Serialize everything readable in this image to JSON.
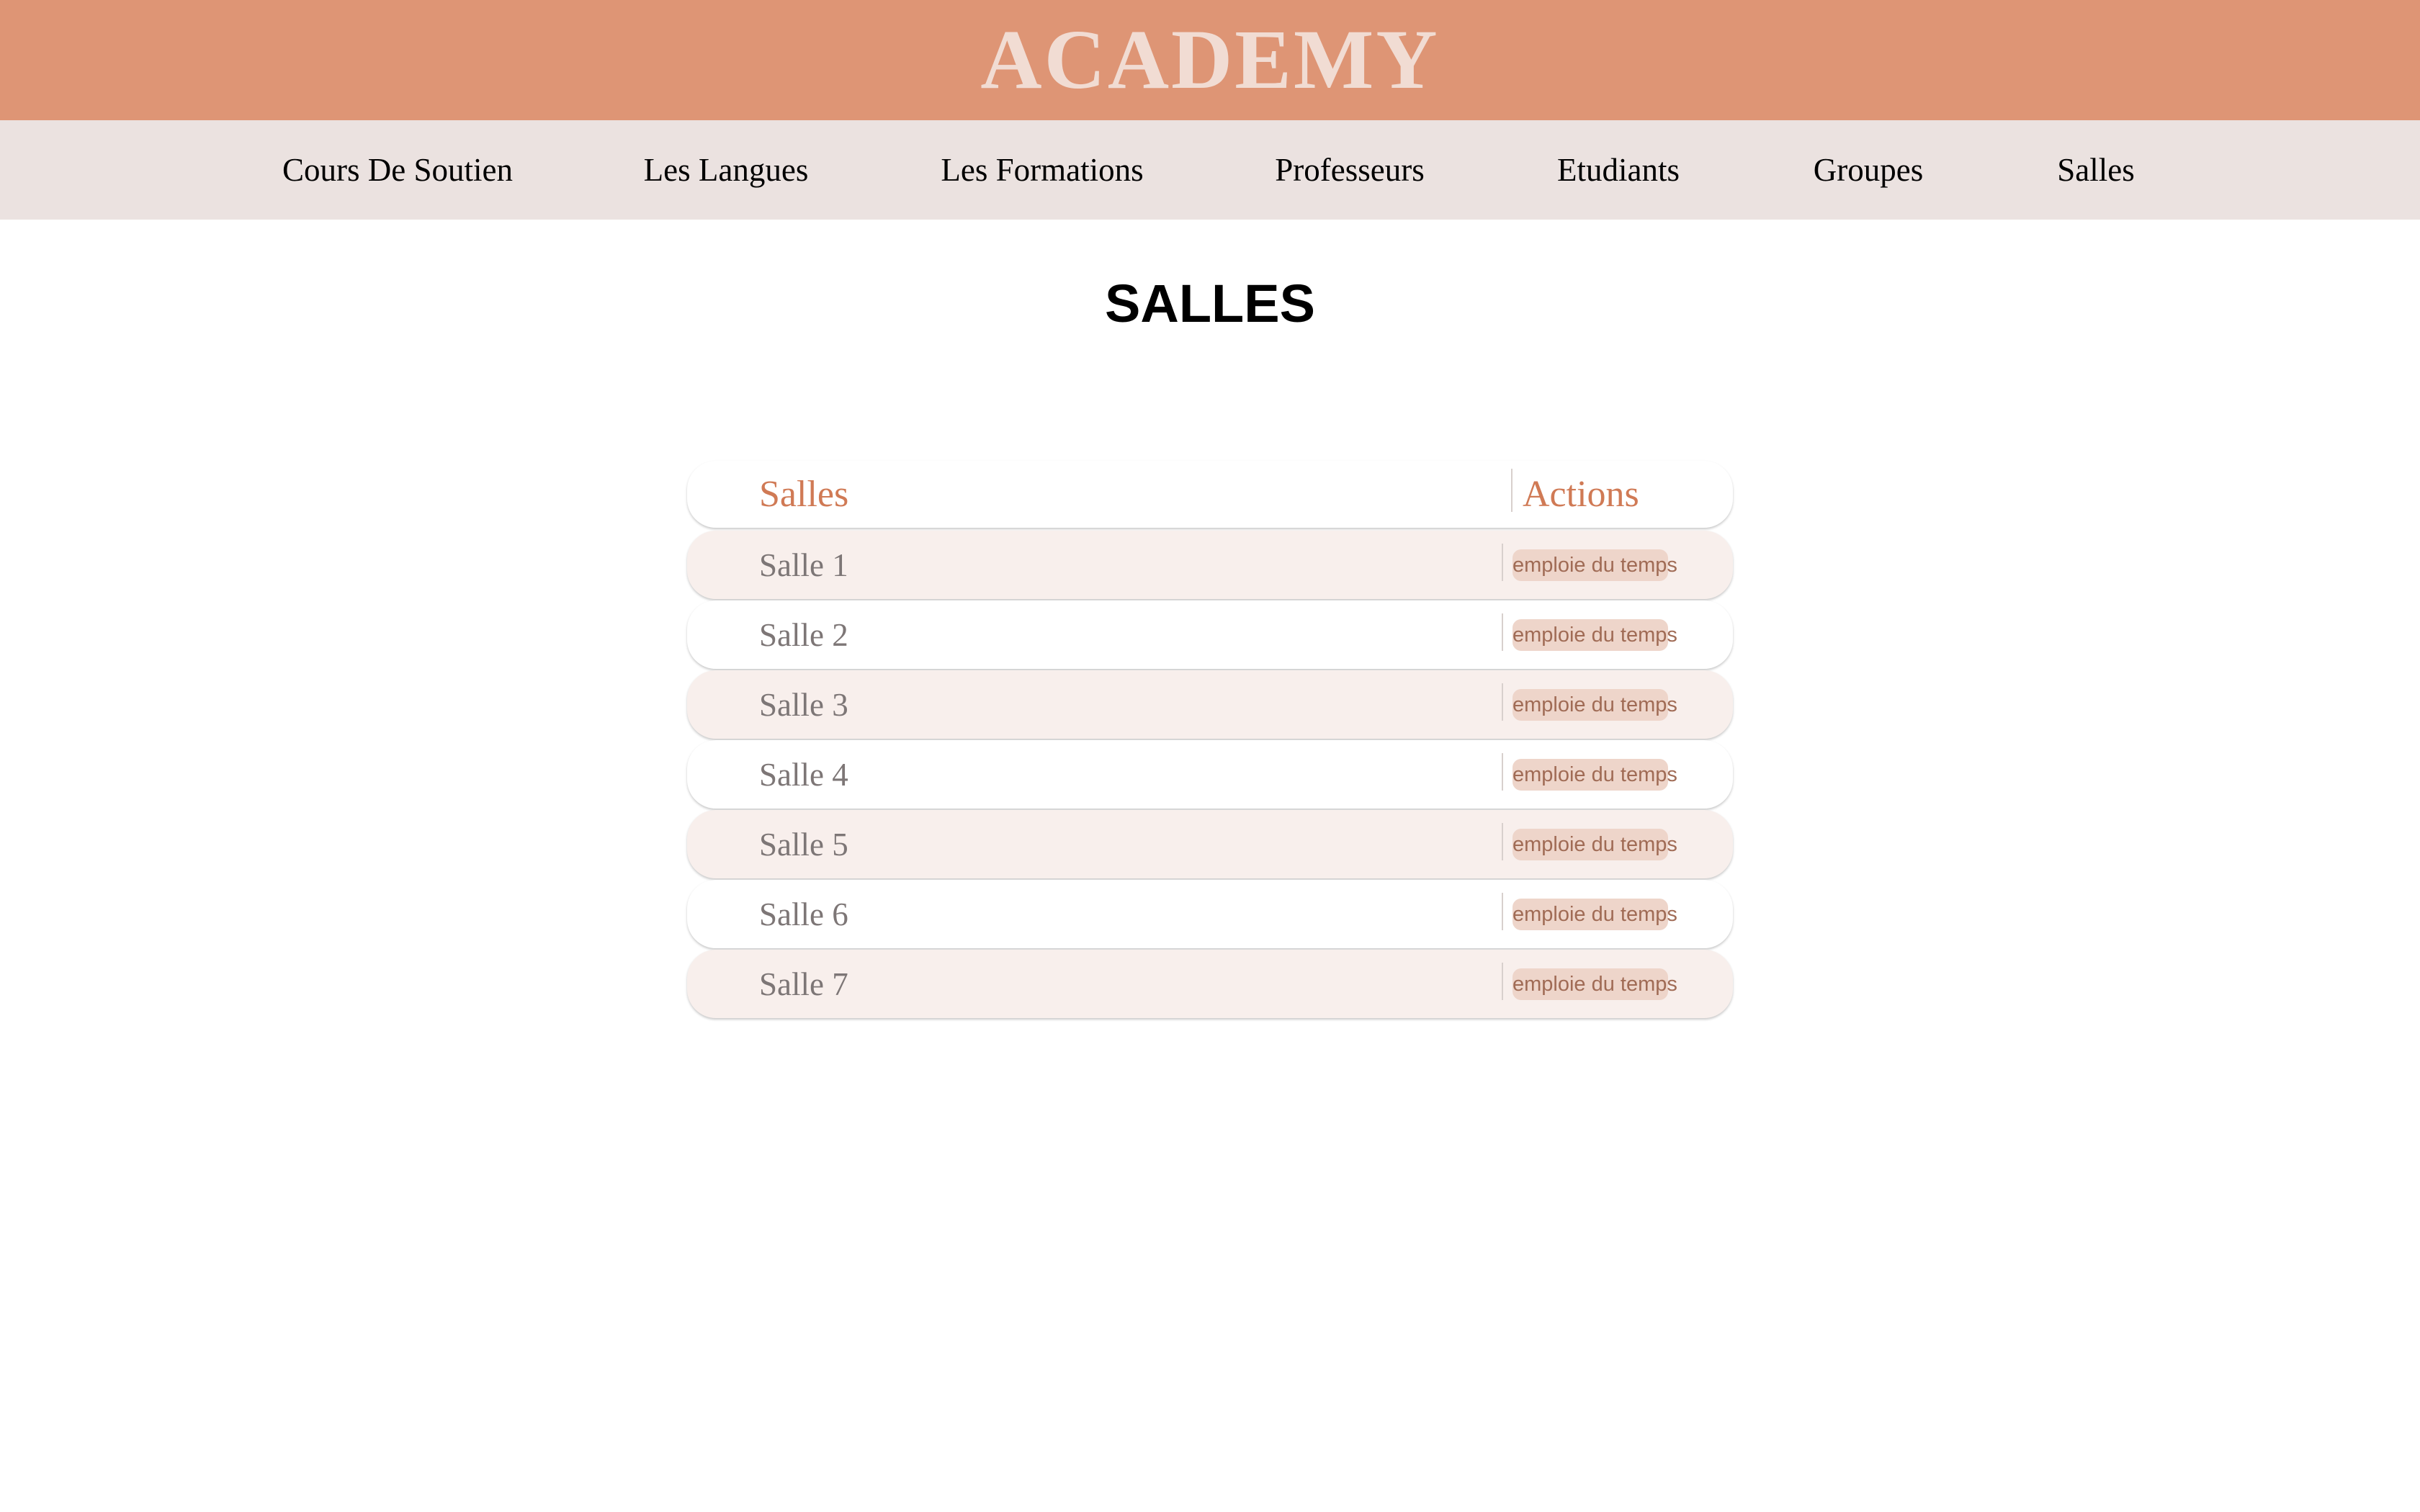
{
  "banner": {
    "title": "ACADEMY",
    "background": "#de9575",
    "text_color": "#f1dcd3"
  },
  "nav": {
    "items": [
      {
        "label": "Cours De Soutien"
      },
      {
        "label": "Les Langues"
      },
      {
        "label": "Les Formations"
      },
      {
        "label": "Professeurs"
      },
      {
        "label": "Etudiants"
      },
      {
        "label": "Groupes"
      },
      {
        "label": "Salles"
      }
    ],
    "background": "#ebe2e0"
  },
  "page": {
    "heading": "SALLES"
  },
  "table": {
    "headers": {
      "name": "Salles",
      "actions": "Actions"
    },
    "accent_color": "#d07a55",
    "rows": [
      {
        "name": "Salle 1",
        "action_label": "emploie du temps"
      },
      {
        "name": "Salle 2",
        "action_label": "emploie du temps"
      },
      {
        "name": "Salle 3",
        "action_label": "emploie du temps"
      },
      {
        "name": "Salle 4",
        "action_label": "emploie du temps"
      },
      {
        "name": "Salle 5",
        "action_label": "emploie du temps"
      },
      {
        "name": "Salle 6",
        "action_label": "emploie du temps"
      },
      {
        "name": "Salle 7",
        "action_label": "emploie du temps"
      }
    ]
  }
}
